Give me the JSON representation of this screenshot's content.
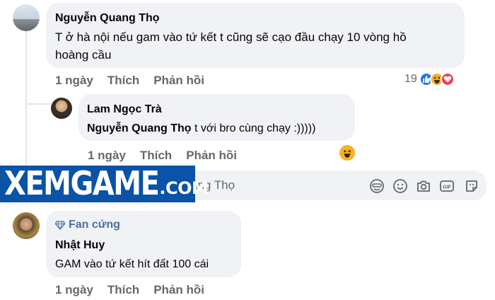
{
  "comments": [
    {
      "author": "Nguyễn Quang Thọ",
      "line1": "T ở hà nội nếu gam vào tứ kết t cũng sẽ cạo đầu chạy 10 vòng hồ",
      "line2": "hoàng cầu",
      "time": "1 ngày",
      "like": "Thích",
      "reply": "Phản hồi",
      "reaction_count": "19",
      "reaction_icons": [
        "like-icon",
        "haha-icon",
        "love-icon"
      ]
    },
    {
      "author": "Lam Ngọc Trà",
      "mention": "Nguyễn Quang Thọ",
      "text": " t với bro cùng chạy :)))))",
      "time": "1 ngày",
      "like": "Thích",
      "reply": "Phản hồi",
      "reaction_icons": [
        "haha-icon"
      ]
    },
    {
      "badge": "Fan cứng",
      "author": "Nhật Huy",
      "text": "GAM vào tứ kết hít đất 100 cái",
      "time": "1 ngày",
      "like": "Thích",
      "reply": "Phản hồi"
    }
  ],
  "reply_box": {
    "placeholder": "Trả lời Nguyễn Quang Thọ",
    "visible_placeholder": "ang Thọ",
    "tools": [
      "sticker-face-icon",
      "emoji-icon",
      "camera-icon",
      "gif-icon",
      "sticker-icon"
    ]
  },
  "watermark": {
    "main": "XEMGAME",
    "suffix": ".COM"
  },
  "colors": {
    "bubble": "#f0f2f5",
    "secondary_text": "#65676b",
    "like_blue": "#1877f2",
    "love_red": "#f33e58",
    "haha_yellow": "#f7b125",
    "watermark_blue": "#0a53a6"
  }
}
